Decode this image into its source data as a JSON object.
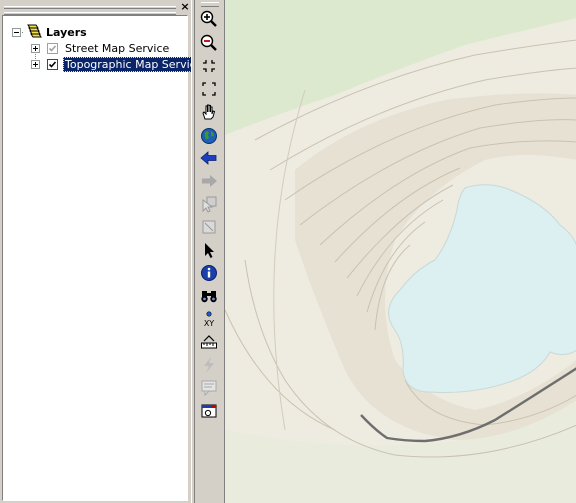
{
  "toc": {
    "close_glyph": "×",
    "root": {
      "label": "Layers",
      "icon": "layers-icon"
    },
    "layers": [
      {
        "label": "Street Map Service",
        "checked": true,
        "enabled": false,
        "selected": false
      },
      {
        "label": "Topographic Map Service",
        "checked": true,
        "enabled": true,
        "selected": true
      }
    ]
  },
  "toolbar": {
    "tools": [
      {
        "name": "zoom-in-icon",
        "enabled": true
      },
      {
        "name": "zoom-out-icon",
        "enabled": true
      },
      {
        "name": "fixed-zoom-in-icon",
        "enabled": true
      },
      {
        "name": "fixed-zoom-out-icon",
        "enabled": true
      },
      {
        "name": "pan-hand-icon",
        "enabled": true
      },
      {
        "name": "full-extent-globe-icon",
        "enabled": true
      },
      {
        "name": "back-arrow-icon",
        "enabled": true
      },
      {
        "name": "forward-arrow-icon",
        "enabled": false
      },
      {
        "name": "select-features-icon",
        "enabled": false
      },
      {
        "name": "clear-selection-icon",
        "enabled": false
      },
      {
        "name": "select-elements-arrow-icon",
        "enabled": true
      },
      {
        "name": "identify-icon",
        "enabled": true
      },
      {
        "name": "find-binoculars-icon",
        "enabled": true
      },
      {
        "name": "go-to-xy-icon",
        "enabled": true,
        "label": "XY"
      },
      {
        "name": "measure-icon",
        "enabled": true
      },
      {
        "name": "hyperlink-lightning-icon",
        "enabled": false
      },
      {
        "name": "html-popup-icon",
        "enabled": false
      },
      {
        "name": "time-slider-window-icon",
        "enabled": true
      }
    ]
  },
  "map": {
    "colors": {
      "land": "#eeebe0",
      "vegetation": "#dde9cf",
      "water": "#dcf0f2",
      "contour": "#c9c2b0",
      "road": "#6e6e6e"
    }
  }
}
